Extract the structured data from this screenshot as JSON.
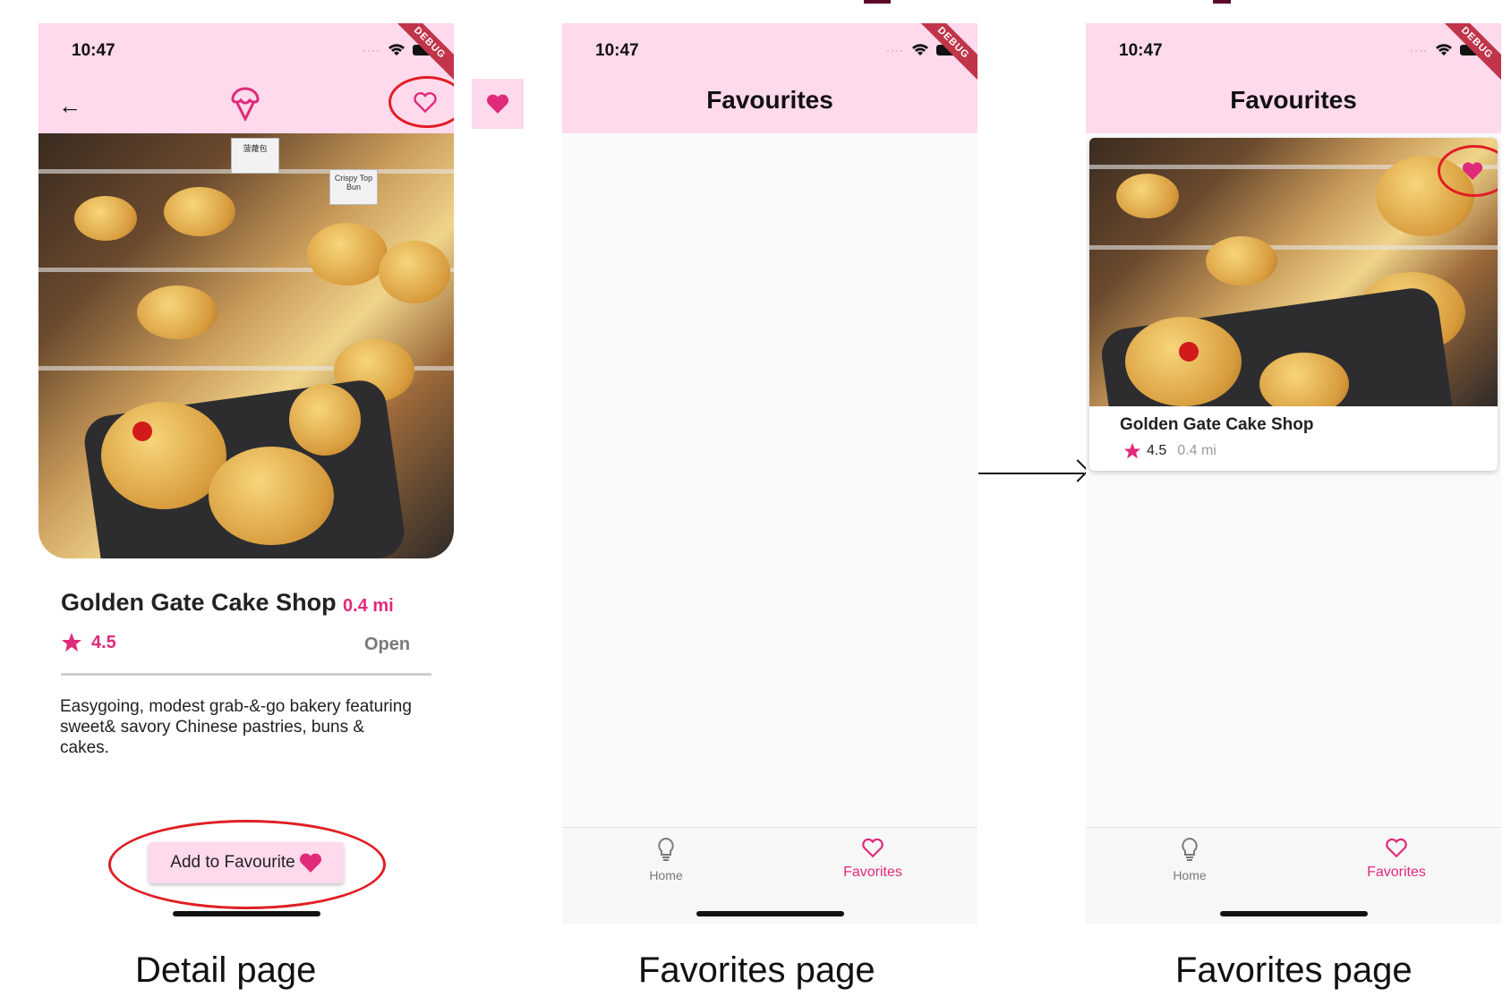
{
  "status_time": "10:47",
  "debug_label": "DEBUG",
  "detail": {
    "shop_name": "Golden Gate Cake Shop",
    "distance": "0.4 mi",
    "rating": "4.5",
    "open_status": "Open",
    "description": "Easygoing, modest grab-&-go bakery featuring sweet& savory Chinese pastries, buns & cakes.",
    "fav_button_label": "Add to Favourite",
    "photo_tag_1": "菠蘿包",
    "photo_tag_2": "Crispy Top Bun"
  },
  "favorites_empty": {
    "title": "Favourites"
  },
  "favorites_filled": {
    "title": "Favourites",
    "card_name": "Golden Gate Cake Shop",
    "card_rating": "4.5",
    "card_distance": "0.4 mi"
  },
  "bottom_nav": {
    "home": "Home",
    "favorites": "Favorites"
  },
  "captions": {
    "detail": "Detail page",
    "favorites_1": "Favorites page",
    "favorites_2": "Favorites page"
  },
  "colors": {
    "appbar": "#ffd9ec",
    "accent": "#e02a7a",
    "annotation": "#e01e24"
  },
  "icons": [
    "back-arrow-icon",
    "ice-cream-icon",
    "heart-outline-icon",
    "heart-filled-icon",
    "star-icon",
    "lightbulb-icon",
    "wifi-icon",
    "battery-icon"
  ]
}
